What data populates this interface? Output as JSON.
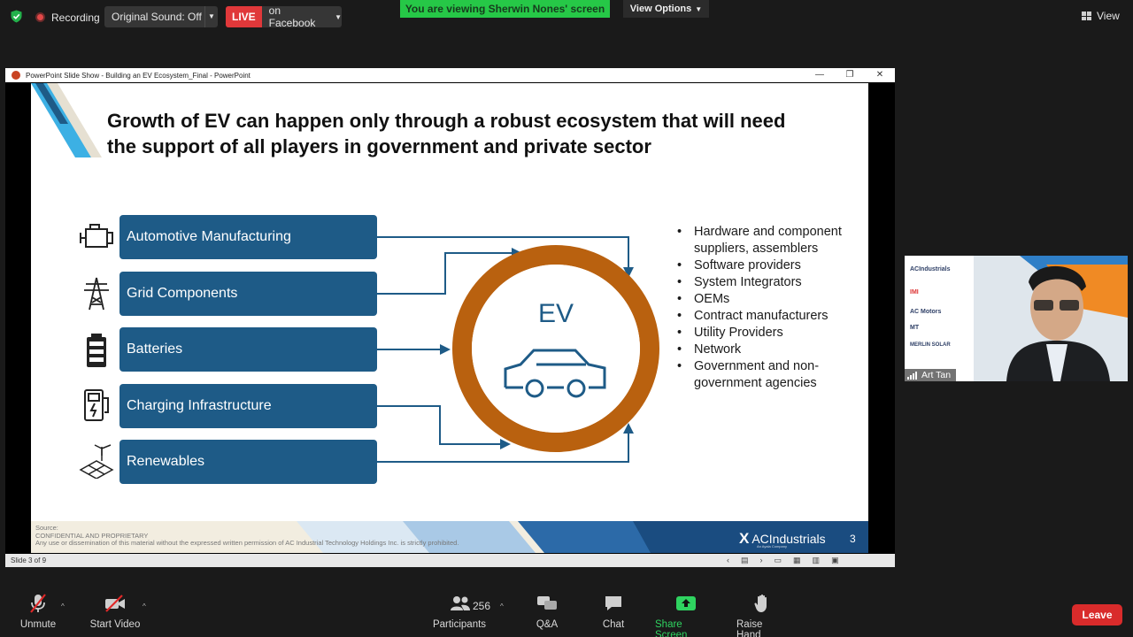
{
  "topbar": {
    "recording_label": "Recording",
    "original_sound_label": "Original Sound: Off",
    "live_badge": "LIVE",
    "live_destination": "on Facebook",
    "viewing_banner": "You are viewing Sherwin Nones' screen",
    "view_options_label": "View Options",
    "view_label": "View"
  },
  "ppt": {
    "window_title": "PowerPoint Slide Show  -  Building an EV Ecosystem_Final - PowerPoint",
    "status_slide": "Slide 3 of 9"
  },
  "slide": {
    "title_line1": "Growth of EV can happen only through a robust ecosystem that will need",
    "title_line2": "the support of all players in government and private sector",
    "categories": [
      {
        "label": "Automotive Manufacturing",
        "icon": "engine-icon"
      },
      {
        "label": "Grid Components",
        "icon": "power-tower-icon"
      },
      {
        "label": "Batteries",
        "icon": "battery-icon"
      },
      {
        "label": "Charging Infrastructure",
        "icon": "charger-icon"
      },
      {
        "label": "Renewables",
        "icon": "solar-wind-icon"
      }
    ],
    "center_label": "EV",
    "bullets": [
      "Hardware and component suppliers, assemblers",
      "Software providers",
      "System Integrators",
      "OEMs",
      "Contract manufacturers",
      "Utility Providers",
      "Network",
      "Government and non-government agencies"
    ],
    "footer_source": "Source:",
    "footer_confidential": "CONFIDENTIAL AND PROPRIETARY",
    "footer_notice": "Any use or dissemination of this material without the expressed written permission of AC Industrial Technology Holdings Inc. is strictly prohibited.",
    "brand_name": "ACIndustrials",
    "brand_tagline": "An Ayala Company",
    "page_number": "3",
    "colors": {
      "box": "#1e5b87",
      "ring": "#b9610f",
      "arrow": "#1e5b87"
    }
  },
  "video": {
    "participant_name": "Art Tan",
    "logos": [
      "ACIndustrials",
      "IMI",
      "AC Motors",
      "MT",
      "MERLIN SOLAR"
    ]
  },
  "toolbar": {
    "unmute_label": "Unmute",
    "start_video_label": "Start Video",
    "participants_label": "Participants",
    "participants_count": "256",
    "qa_label": "Q&A",
    "chat_label": "Chat",
    "share_label": "Share Screen",
    "raise_hand_label": "Raise Hand",
    "leave_label": "Leave"
  }
}
